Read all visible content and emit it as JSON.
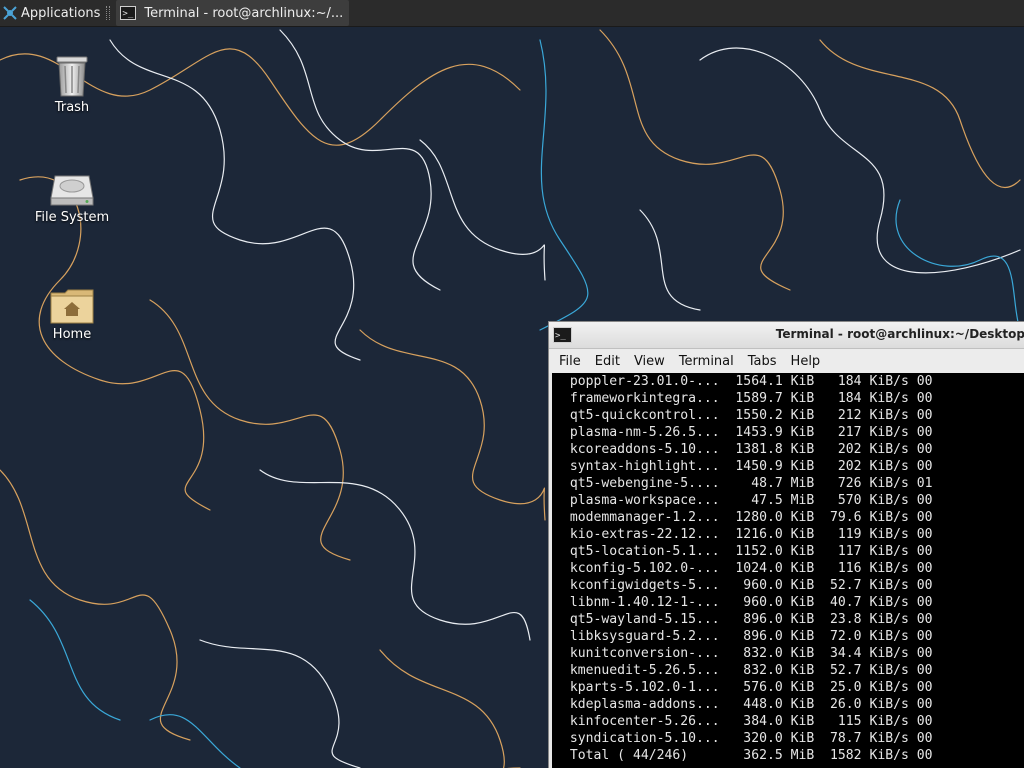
{
  "panel": {
    "applications_label": "Applications",
    "task_title": "Terminal - root@archlinux:~/..."
  },
  "desktop": {
    "icons": [
      {
        "label": "Trash"
      },
      {
        "label": "File System"
      },
      {
        "label": "Home"
      }
    ]
  },
  "colors": {
    "wallpaper_bg": "#1c2738",
    "line_orange": "#d7a15e",
    "line_white": "#e9edf2",
    "line_blue": "#3aa8d8",
    "terminal_bg": "#000000",
    "terminal_fg": "#e6e6e6"
  },
  "terminal": {
    "title": "Terminal - root@archlinux:~/Desktop",
    "menu": [
      "File",
      "Edit",
      "View",
      "Terminal",
      "Tabs",
      "Help"
    ],
    "lines": [
      " poppler-23.01.0-...  1564.1 KiB   184 KiB/s 00",
      " frameworkintegra...  1589.7 KiB   184 KiB/s 00",
      " qt5-quickcontrol...  1550.2 KiB   212 KiB/s 00",
      " plasma-nm-5.26.5...  1453.9 KiB   217 KiB/s 00",
      " kcoreaddons-5.10...  1381.8 KiB   202 KiB/s 00",
      " syntax-highlight...  1450.9 KiB   202 KiB/s 00",
      " qt5-webengine-5....    48.7 MiB   726 KiB/s 01",
      " plasma-workspace...    47.5 MiB   570 KiB/s 00",
      " modemmanager-1.2...  1280.0 KiB  79.6 KiB/s 00",
      " kio-extras-22.12...  1216.0 KiB   119 KiB/s 00",
      " qt5-location-5.1...  1152.0 KiB   117 KiB/s 00",
      " kconfig-5.102.0-...  1024.0 KiB   116 KiB/s 00",
      " kconfigwidgets-5...   960.0 KiB  52.7 KiB/s 00",
      " libnm-1.40.12-1-...   960.0 KiB  40.7 KiB/s 00",
      " qt5-wayland-5.15...   896.0 KiB  23.8 KiB/s 00",
      " libksysguard-5.2...   896.0 KiB  72.0 KiB/s 00",
      " kunitconversion-...   832.0 KiB  34.4 KiB/s 00",
      " kmenuedit-5.26.5...   832.0 KiB  52.7 KiB/s 00",
      " kparts-5.102.0-1...   576.0 KiB  25.0 KiB/s 00",
      " kdeplasma-addons...   448.0 KiB  26.0 KiB/s 00",
      " kinfocenter-5.26...   384.0 KiB   115 KiB/s 00",
      " syndication-5.10...   320.0 KiB  78.7 KiB/s 00",
      " Total ( 44/246)       362.5 MiB  1582 KiB/s 00"
    ]
  }
}
